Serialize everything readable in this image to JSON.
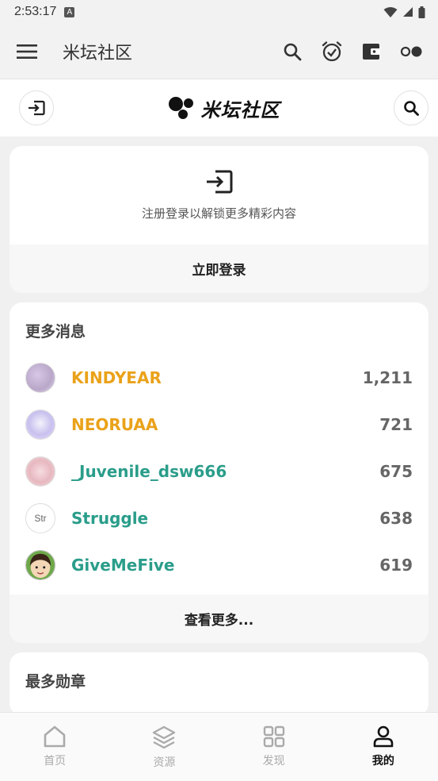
{
  "status_bar": {
    "time": "2:53:17",
    "badge": "A"
  },
  "app_bar": {
    "title": "米坛社区",
    "icons": [
      "menu-icon",
      "search-icon",
      "alarm-check-icon",
      "wallet-icon",
      "toggle-dots-icon"
    ]
  },
  "brand_bar": {
    "brand_name": "米坛社区"
  },
  "login_card": {
    "hint": "注册登录以解锁更多精彩内容",
    "button_label": "立即登录"
  },
  "messages_card": {
    "title": "更多消息",
    "rows": [
      {
        "name": "KINDYEAR",
        "score": "1,211",
        "color": "#eaa21a"
      },
      {
        "name": "NEORUAA",
        "score": "721",
        "color": "#eaa21a"
      },
      {
        "name": "_Juvenile_dsw666",
        "score": "675",
        "color": "#2a9d8a"
      },
      {
        "name": "Struggle",
        "score": "638",
        "color": "#2a9d8a",
        "avatar_text": "Str"
      },
      {
        "name": "GiveMeFive",
        "score": "619",
        "color": "#2a9d8a"
      }
    ],
    "more_label": "查看更多..."
  },
  "badges_card": {
    "title": "最多勋章"
  },
  "bottom_nav": [
    {
      "label": "首页",
      "icon": "home-icon"
    },
    {
      "label": "资源",
      "icon": "layers-icon"
    },
    {
      "label": "发现",
      "icon": "grid-icon"
    },
    {
      "label": "我的",
      "icon": "user-icon",
      "active": true
    }
  ]
}
